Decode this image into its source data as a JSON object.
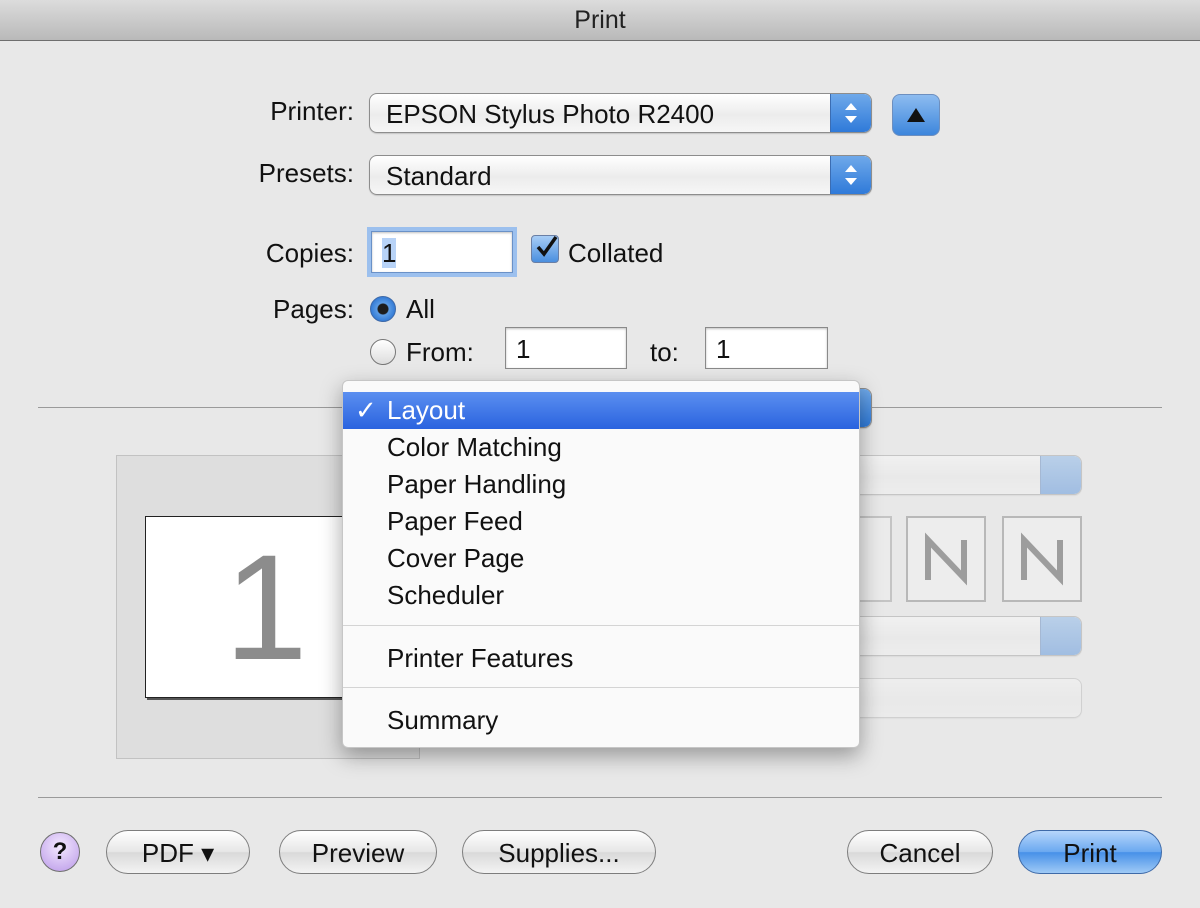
{
  "window": {
    "title": "Print"
  },
  "printer": {
    "label": "Printer:",
    "value": "EPSON Stylus Photo R2400"
  },
  "presets": {
    "label": "Presets:",
    "value": "Standard"
  },
  "copies": {
    "label": "Copies:",
    "value": "1",
    "collated_label": "Collated",
    "collated_checked": true
  },
  "pages": {
    "label": "Pages:",
    "all_label": "All",
    "from_label": "From:",
    "to_label": "to:",
    "from_value": "1",
    "to_value": "1",
    "selected": "All"
  },
  "preview": {
    "page_number": "1"
  },
  "panel_menu": {
    "items": [
      "Layout",
      "Color Matching",
      "Paper Handling",
      "Paper Feed",
      "Cover Page",
      "Scheduler",
      "Printer Features",
      "Summary"
    ],
    "selected": "Layout",
    "check": "✓"
  },
  "buttons": {
    "help": "?",
    "pdf": "PDF ▾",
    "preview": "Preview",
    "supplies": "Supplies...",
    "cancel": "Cancel",
    "print": "Print"
  },
  "colors": {
    "accent": "#2a63df",
    "focus_ring": "#9cc0ee"
  }
}
